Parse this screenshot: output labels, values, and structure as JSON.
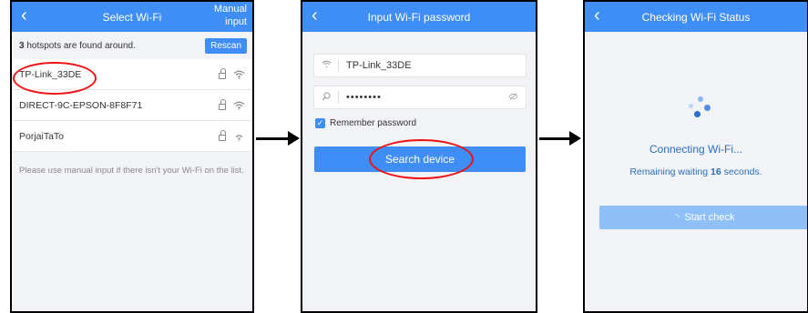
{
  "screen1": {
    "title": "Select Wi-Fi",
    "manual_line1": "Manual",
    "manual_line2": "input",
    "found_count": "3",
    "found_text": " hotspots are found around.",
    "rescan_label": "Rescan",
    "networks": [
      {
        "ssid": "TP-Link_33DE"
      },
      {
        "ssid": "DIRECT-9C-EPSON-8F8F71"
      },
      {
        "ssid": "PorjaiTaTo"
      }
    ],
    "hint": "Please use manual input if there isn't your Wi-Fi on the list."
  },
  "screen2": {
    "title": "Input Wi-Fi password",
    "ssid_value": "TP-Link_33DE",
    "password_value": "••••••••",
    "remember_label": "Remember password",
    "search_label": "Search device"
  },
  "screen3": {
    "title": "Checking Wi-Fi Status",
    "connecting_label": "Connecting Wi-Fi...",
    "remaining_prefix": "Remaining waiting ",
    "remaining_seconds": "16",
    "remaining_suffix": " seconds.",
    "start_label": "Start check"
  },
  "icons": {
    "back": "chevron-left-icon",
    "wifi": "wifi-icon",
    "lock": "lock-icon",
    "search": "key-search-icon",
    "eye": "eye-off-icon",
    "checkbox": "check-icon",
    "loader": "loading-spinner-icon",
    "arrow": "flow-arrow-icon"
  },
  "colors": {
    "header_blue": "#3f8ef5",
    "highlight_red": "#e11111",
    "status_text_blue": "#2a6fb8",
    "disabled_button": "#8ec0f7"
  }
}
